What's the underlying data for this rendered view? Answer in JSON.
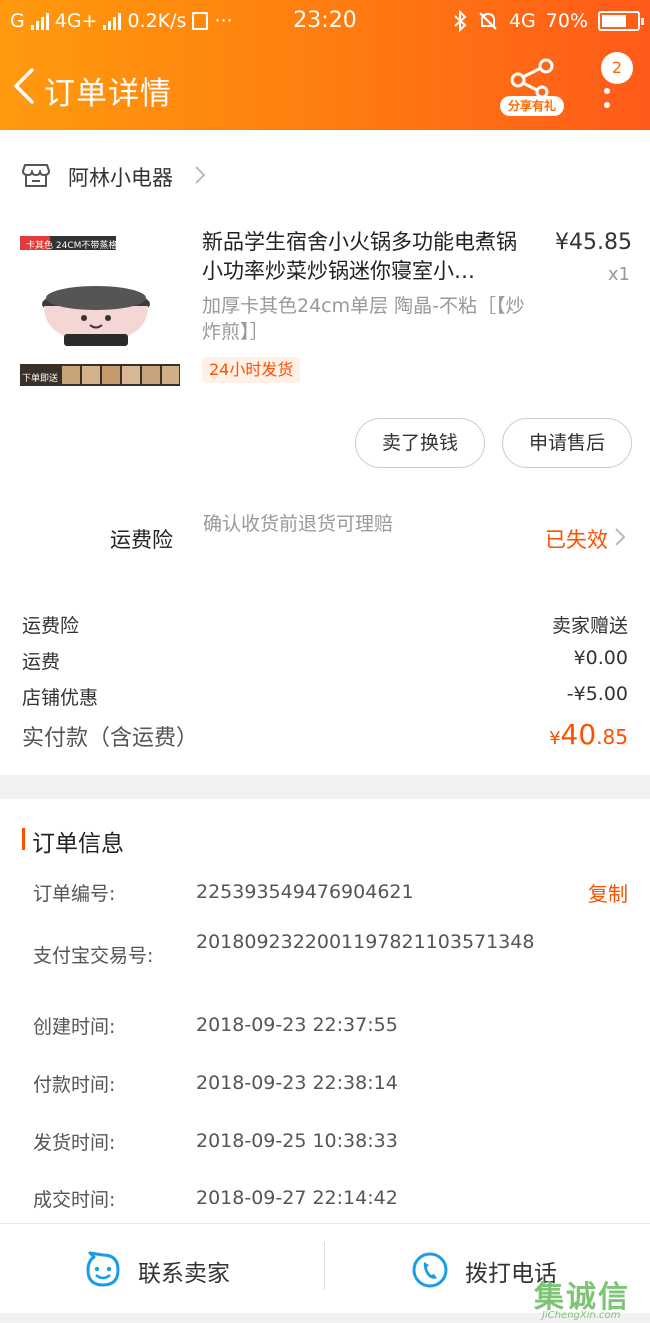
{
  "status_bar": {
    "carrier": "G",
    "network": "4G+",
    "speed": "0.2K/s",
    "more": "···",
    "time": "23:20",
    "net2": "4G",
    "battery": "70%",
    "battery_level": 0.7
  },
  "header": {
    "title": "订单详情",
    "share_label": "分享有礼",
    "more_badge": "2"
  },
  "shop": {
    "name": "阿林小电器"
  },
  "product": {
    "image_banner": "卡其色 24CM不带蒸格",
    "image_footer": "下单即送",
    "title": "新品学生宿舍小火锅多功能电煮锅小功率炒菜炒锅迷你寝室小…",
    "price": "¥45.85",
    "qty": "x1",
    "sku": "加厚卡其色24cm单层 陶晶-不粘［【炒炸煎】］",
    "ship_tag": "24小时发货"
  },
  "actions": {
    "sell_label": "卖了换钱",
    "aftersale_label": "申请售后"
  },
  "insurance": {
    "name": "运费险",
    "desc": "确认收货前退货可理赔",
    "status": "已失效"
  },
  "fees": [
    {
      "label": "运费险",
      "value": "卖家赠送"
    },
    {
      "label": "运费",
      "value": "¥0.00"
    },
    {
      "label": "店铺优惠",
      "value": "-¥5.00"
    }
  ],
  "total": {
    "label": "实付款（含运费）",
    "symbol": "¥",
    "int": "40",
    "dec": ".85"
  },
  "order_info": {
    "title": "订单信息",
    "copy_label": "复制",
    "rows": [
      {
        "label": "订单编号:",
        "value": "225393549476904621"
      },
      {
        "label": "支付宝交易号:",
        "value": "2018092322001197821103571348"
      },
      {
        "label": "创建时间:",
        "value": "2018-09-23 22:37:55"
      },
      {
        "label": "付款时间:",
        "value": "2018-09-23 22:38:14"
      },
      {
        "label": "发货时间:",
        "value": "2018-09-25 10:38:33"
      },
      {
        "label": "成交时间:",
        "value": "2018-09-27 22:14:42"
      }
    ]
  },
  "bottom": {
    "contact_label": "联系卖家",
    "call_label": "拨打电话"
  },
  "watermark": {
    "text": "集诚信",
    "url": "JiChengXin.com"
  },
  "colors": {
    "brand": "#ff6a00",
    "accent": "#ff5000",
    "icon_blue": "#1a9de8"
  }
}
